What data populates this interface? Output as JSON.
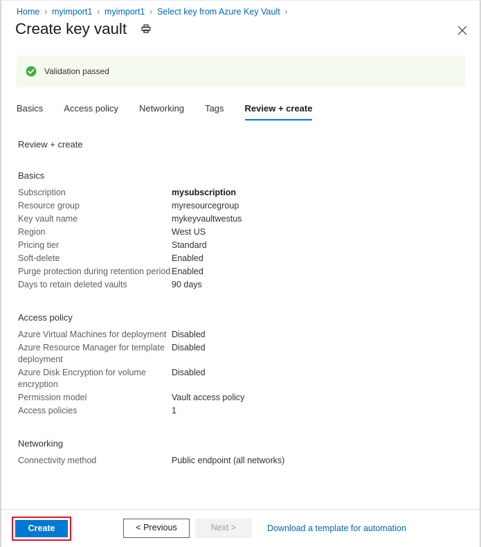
{
  "breadcrumb": {
    "separator": "›",
    "items": [
      {
        "label": "Home"
      },
      {
        "label": "myimport1"
      },
      {
        "label": "myimport1"
      },
      {
        "label": "Select key from Azure Key Vault"
      }
    ]
  },
  "header": {
    "title": "Create key vault",
    "print_icon": "printer-icon",
    "close_icon": "close-icon"
  },
  "validation": {
    "icon": "success-check-icon",
    "text": "Validation passed",
    "background": "#f4faee",
    "icon_color": "#3faf3f"
  },
  "tabs": [
    {
      "label": "Basics",
      "active": false
    },
    {
      "label": "Access policy",
      "active": false
    },
    {
      "label": "Networking",
      "active": false
    },
    {
      "label": "Tags",
      "active": false
    },
    {
      "label": "Review + create",
      "active": true
    }
  ],
  "main": {
    "heading": "Review + create",
    "sections": [
      {
        "title": "Basics",
        "rows": [
          {
            "key": "Subscription",
            "value": "mysubscription",
            "emphasis": true
          },
          {
            "key": "Resource group",
            "value": "myresourcegroup",
            "emphasis": false
          },
          {
            "key": "Key vault name",
            "value": "mykeyvaultwestus",
            "emphasis": false
          },
          {
            "key": "Region",
            "value": "West US",
            "emphasis": false
          },
          {
            "key": "Pricing tier",
            "value": "Standard",
            "emphasis": false
          },
          {
            "key": "Soft-delete",
            "value": "Enabled",
            "emphasis": false
          },
          {
            "key": "Purge protection during retention period",
            "value": "Enabled",
            "emphasis": false
          },
          {
            "key": "Days to retain deleted vaults",
            "value": "90 days",
            "emphasis": false
          }
        ]
      },
      {
        "title": "Access policy",
        "rows": [
          {
            "key": "Azure Virtual Machines for deployment",
            "value": "Disabled",
            "emphasis": false
          },
          {
            "key": "Azure Resource Manager for template deployment",
            "value": "Disabled",
            "emphasis": false
          },
          {
            "key": "Azure Disk Encryption for volume encryption",
            "value": "Disabled",
            "emphasis": false
          },
          {
            "key": "Permission model",
            "value": "Vault access policy",
            "emphasis": false
          },
          {
            "key": "Access policies",
            "value": "1",
            "emphasis": false
          }
        ]
      },
      {
        "title": "Networking",
        "rows": [
          {
            "key": "Connectivity method",
            "value": "Public endpoint (all networks)",
            "emphasis": false
          }
        ]
      }
    ]
  },
  "footer": {
    "create_label": "Create",
    "previous_label": "< Previous",
    "next_label": "Next >",
    "download_label": "Download a template for automation",
    "create_color": "#0078d4",
    "highlight_color": "#e81123",
    "link_color": "#0067b8"
  }
}
